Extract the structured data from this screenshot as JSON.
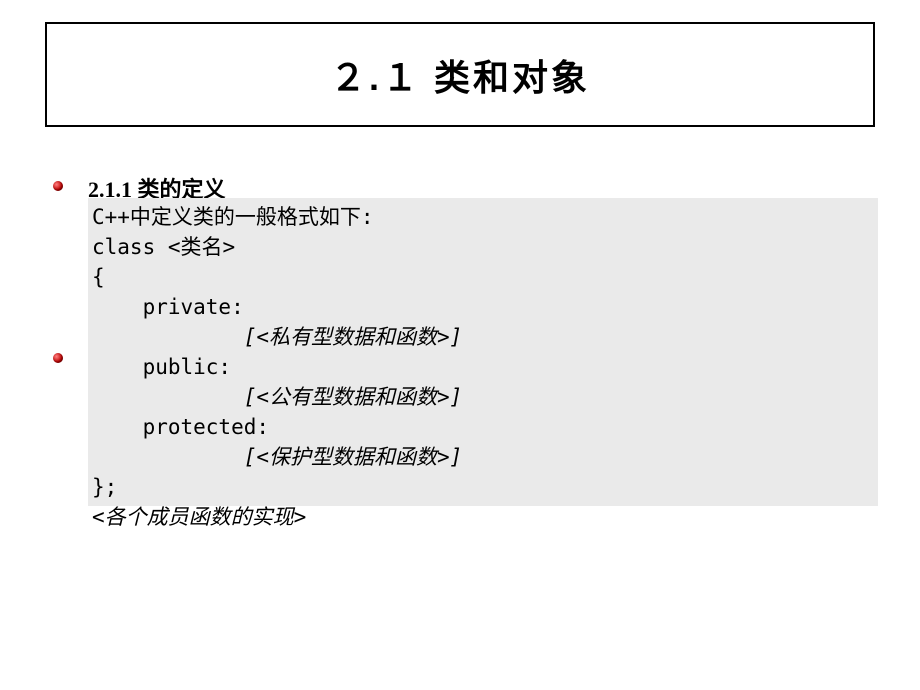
{
  "title": "２.１ 类和对象",
  "section_heading": "2.1.1  类的定义",
  "code": {
    "line1": "C++中定义类的一般格式如下:",
    "line2": "class <类名>",
    "line3": "{",
    "line4": "    private:",
    "line5": "            [<私有型数据和函数>]",
    "line6": "    public:",
    "line7": "            [<公有型数据和函数>]",
    "line8": "    protected:",
    "line9": "            [<保护型数据和函数>]",
    "line10": "};",
    "line11": "<各个成员函数的实现>"
  }
}
